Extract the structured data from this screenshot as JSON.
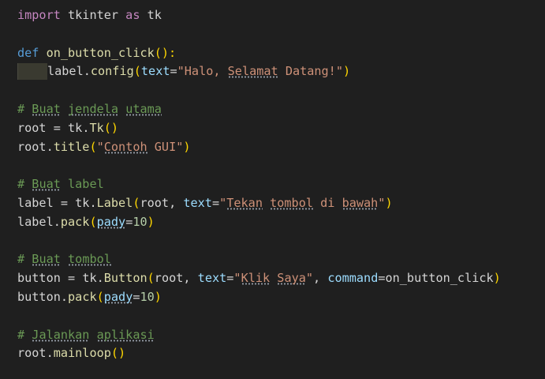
{
  "editor": {
    "lines": [
      {
        "parts": [
          {
            "t": "import",
            "c": "kw2"
          },
          {
            "t": " tkinter ",
            "c": "id"
          },
          {
            "t": "as",
            "c": "kw2"
          },
          {
            "t": " tk",
            "c": "id"
          }
        ]
      },
      {
        "parts": []
      },
      {
        "parts": [
          {
            "t": "def",
            "c": "kw"
          },
          {
            "t": " ",
            "c": "id"
          },
          {
            "t": "on_button_click",
            "c": "fn"
          },
          {
            "t": "():",
            "c": "paren"
          }
        ]
      },
      {
        "indent": true,
        "parts": [
          {
            "t": "label",
            "c": "id"
          },
          {
            "t": ".",
            "c": "id"
          },
          {
            "t": "config",
            "c": "fn"
          },
          {
            "t": "(",
            "c": "paren"
          },
          {
            "t": "text",
            "c": "var"
          },
          {
            "t": "=",
            "c": "id"
          },
          {
            "t": "\"Halo, ",
            "c": "str"
          },
          {
            "t": "Selamat",
            "c": "str",
            "sq": true
          },
          {
            "t": " Datang!\"",
            "c": "str"
          },
          {
            "t": ")",
            "c": "paren"
          }
        ]
      },
      {
        "parts": []
      },
      {
        "parts": [
          {
            "t": "# ",
            "c": "cm"
          },
          {
            "t": "Buat",
            "c": "cm",
            "sq": true
          },
          {
            "t": " ",
            "c": "cm"
          },
          {
            "t": "jendela",
            "c": "cm",
            "sq": true
          },
          {
            "t": " ",
            "c": "cm"
          },
          {
            "t": "utama",
            "c": "cm",
            "sq": true
          }
        ]
      },
      {
        "parts": [
          {
            "t": "root",
            "c": "id"
          },
          {
            "t": " = ",
            "c": "id"
          },
          {
            "t": "tk",
            "c": "id"
          },
          {
            "t": ".",
            "c": "id"
          },
          {
            "t": "Tk",
            "c": "fn"
          },
          {
            "t": "()",
            "c": "paren"
          }
        ]
      },
      {
        "parts": [
          {
            "t": "root",
            "c": "id"
          },
          {
            "t": ".",
            "c": "id"
          },
          {
            "t": "title",
            "c": "fn"
          },
          {
            "t": "(",
            "c": "paren"
          },
          {
            "t": "\"",
            "c": "str"
          },
          {
            "t": "Contoh",
            "c": "str",
            "sq": true
          },
          {
            "t": " GUI\"",
            "c": "str"
          },
          {
            "t": ")",
            "c": "paren"
          }
        ]
      },
      {
        "parts": []
      },
      {
        "parts": [
          {
            "t": "# ",
            "c": "cm"
          },
          {
            "t": "Buat",
            "c": "cm",
            "sq": true
          },
          {
            "t": " label",
            "c": "cm"
          }
        ]
      },
      {
        "parts": [
          {
            "t": "label",
            "c": "id"
          },
          {
            "t": " = ",
            "c": "id"
          },
          {
            "t": "tk",
            "c": "id"
          },
          {
            "t": ".",
            "c": "id"
          },
          {
            "t": "Label",
            "c": "fn"
          },
          {
            "t": "(",
            "c": "paren"
          },
          {
            "t": "root",
            "c": "id"
          },
          {
            "t": ", ",
            "c": "id"
          },
          {
            "t": "text",
            "c": "var"
          },
          {
            "t": "=",
            "c": "id"
          },
          {
            "t": "\"",
            "c": "str"
          },
          {
            "t": "Tekan",
            "c": "str",
            "sq": true
          },
          {
            "t": " ",
            "c": "str"
          },
          {
            "t": "tombol",
            "c": "str",
            "sq": true
          },
          {
            "t": " di ",
            "c": "str"
          },
          {
            "t": "bawah",
            "c": "str",
            "sq": true
          },
          {
            "t": "\"",
            "c": "str"
          },
          {
            "t": ")",
            "c": "paren"
          }
        ]
      },
      {
        "parts": [
          {
            "t": "label",
            "c": "id"
          },
          {
            "t": ".",
            "c": "id"
          },
          {
            "t": "pack",
            "c": "fn"
          },
          {
            "t": "(",
            "c": "paren"
          },
          {
            "t": "pady",
            "c": "var",
            "sq": true
          },
          {
            "t": "=",
            "c": "id"
          },
          {
            "t": "10",
            "c": "num"
          },
          {
            "t": ")",
            "c": "paren"
          }
        ]
      },
      {
        "parts": []
      },
      {
        "parts": [
          {
            "t": "# ",
            "c": "cm"
          },
          {
            "t": "Buat",
            "c": "cm",
            "sq": true
          },
          {
            "t": " ",
            "c": "cm"
          },
          {
            "t": "tombol",
            "c": "cm",
            "sq": true
          }
        ]
      },
      {
        "parts": [
          {
            "t": "button",
            "c": "id"
          },
          {
            "t": " = ",
            "c": "id"
          },
          {
            "t": "tk",
            "c": "id"
          },
          {
            "t": ".",
            "c": "id"
          },
          {
            "t": "Button",
            "c": "fn"
          },
          {
            "t": "(",
            "c": "paren"
          },
          {
            "t": "root",
            "c": "id"
          },
          {
            "t": ", ",
            "c": "id"
          },
          {
            "t": "text",
            "c": "var"
          },
          {
            "t": "=",
            "c": "id"
          },
          {
            "t": "\"",
            "c": "str"
          },
          {
            "t": "Klik",
            "c": "str",
            "sq": true
          },
          {
            "t": " ",
            "c": "str"
          },
          {
            "t": "Saya",
            "c": "str",
            "sq": true
          },
          {
            "t": "\"",
            "c": "str"
          },
          {
            "t": ", ",
            "c": "id"
          },
          {
            "t": "command",
            "c": "var"
          },
          {
            "t": "=",
            "c": "id"
          },
          {
            "t": "on_button_click",
            "c": "id"
          },
          {
            "t": ")",
            "c": "paren"
          }
        ]
      },
      {
        "parts": [
          {
            "t": "button",
            "c": "id"
          },
          {
            "t": ".",
            "c": "id"
          },
          {
            "t": "pack",
            "c": "fn"
          },
          {
            "t": "(",
            "c": "paren"
          },
          {
            "t": "pady",
            "c": "var",
            "sq": true
          },
          {
            "t": "=",
            "c": "id"
          },
          {
            "t": "10",
            "c": "num"
          },
          {
            "t": ")",
            "c": "paren"
          }
        ]
      },
      {
        "parts": []
      },
      {
        "parts": [
          {
            "t": "# ",
            "c": "cm"
          },
          {
            "t": "Jalankan",
            "c": "cm",
            "sq": true
          },
          {
            "t": " ",
            "c": "cm"
          },
          {
            "t": "aplikasi",
            "c": "cm",
            "sq": true
          }
        ]
      },
      {
        "parts": [
          {
            "t": "root",
            "c": "id"
          },
          {
            "t": ".",
            "c": "id"
          },
          {
            "t": "mainloop",
            "c": "fn"
          },
          {
            "t": "()",
            "c": "paren"
          }
        ]
      }
    ]
  },
  "colors": {
    "background": "#1f1f1f",
    "keyword": "#569cd6",
    "import_keyword": "#c586c0",
    "function": "#dcdcaa",
    "string": "#ce9178",
    "number": "#b5cea8",
    "comment": "#6a9955",
    "bracket": "#ffd700",
    "parameter": "#9cdcfe",
    "text": "#d4d4d4"
  }
}
